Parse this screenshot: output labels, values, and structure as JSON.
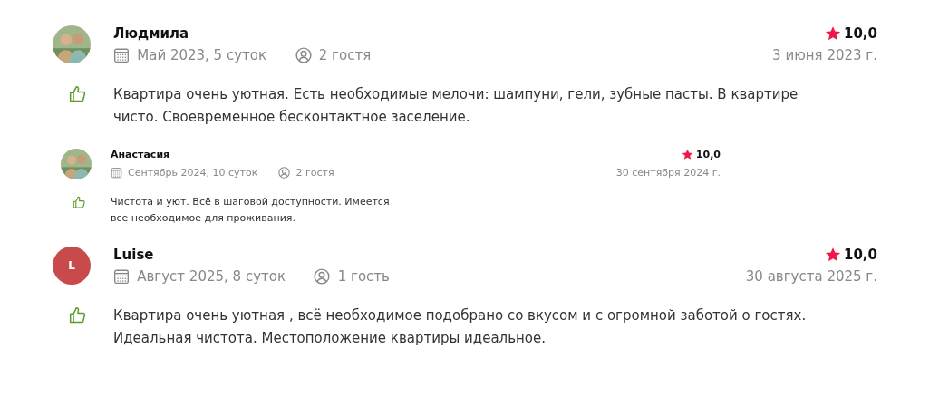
{
  "reviews": [
    {
      "kind": "regular",
      "name": "Людмила",
      "stay": "Май 2023, 5 суток",
      "guests": "2 гостя",
      "rating": "10,0",
      "date": "3 июня 2023 г.",
      "text": "Квартира очень уютная. Есть необходимые мелочи: шампуни, гели, зубные пасты. В квартире чисто. Своевременное бесконтактное заселение."
    },
    {
      "kind": "compact",
      "name": "Анастасия",
      "stay": "Сентябрь 2024, 10 суток",
      "guests": "2 гостя",
      "rating": "10,0",
      "date": "30 сентября 2024 г.",
      "text": "Чистота и уют. Всё в шаговой доступности. Имеется все необходимое для проживания."
    },
    {
      "kind": "regular",
      "avatar": {
        "kind": "letter",
        "letter": "L",
        "color": "#c94a4a"
      },
      "name": "Luise",
      "stay": "Август 2025, 8 суток",
      "guests": "1 гость",
      "rating": "10,0",
      "date": "30 августа 2025 г.",
      "text": "Квартира очень уютная , всё необходимое подобрано со вкусом и с огромной заботой о гостях. Идеальная чистота. Местоположение квартиры идеальное."
    }
  ]
}
